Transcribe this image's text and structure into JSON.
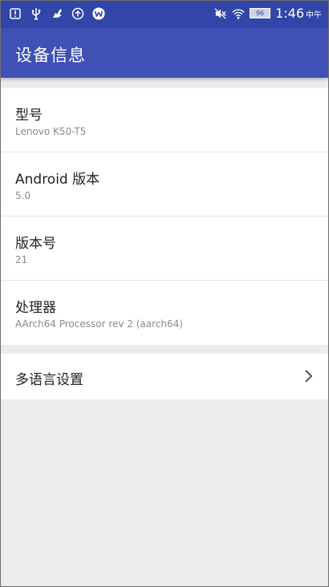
{
  "status_bar": {
    "time": "1:46",
    "time_suffix": "中午",
    "battery": "96",
    "left_icons": [
      "info-icon",
      "usb-icon",
      "notification-icon",
      "upload-icon",
      "w-app-icon"
    ],
    "right_icons": [
      "mute-icon",
      "wifi-icon",
      "battery-icon"
    ]
  },
  "appbar": {
    "title": "设备信息"
  },
  "info": [
    {
      "title": "型号",
      "value": "Lenovo K50-T5"
    },
    {
      "title": "Android 版本",
      "value": "5.0"
    },
    {
      "title": "版本号",
      "value": "21"
    },
    {
      "title": "处理器",
      "value": "AArch64 Processor rev 2 (aarch64)"
    }
  ],
  "language": {
    "label": "多语言设置",
    "icon": "chevron-right-icon"
  },
  "colors": {
    "primary": "#3f51b5",
    "status_bar": "#3245a8",
    "background": "#ececec"
  }
}
